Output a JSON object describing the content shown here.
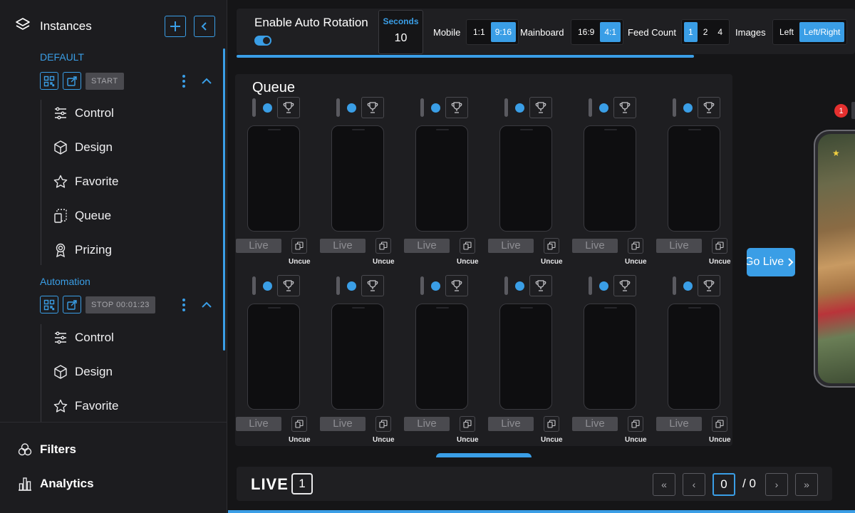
{
  "sidebar": {
    "title": "Instances",
    "instances": [
      {
        "label": "DEFAULT",
        "action_label": "START",
        "items": [
          "Control",
          "Design",
          "Favorite",
          "Queue",
          "Prizing"
        ]
      },
      {
        "label": "Automation",
        "action_label": "STOP 00:01:23",
        "items": [
          "Control",
          "Design",
          "Favorite"
        ]
      }
    ],
    "bottom": [
      "Filters",
      "Analytics"
    ]
  },
  "toolbar": {
    "rotation_label": "Enable Auto Rotation",
    "rotation_enabled": true,
    "seconds_label": "Seconds",
    "seconds_value": "10",
    "mobile_label": "Mobile",
    "mobile_options": [
      "1:1",
      "9:16"
    ],
    "mobile_selected": "9:16",
    "mainboard_label": "Mainboard",
    "mainboard_options": [
      "16:9",
      "4:1"
    ],
    "mainboard_selected": "4:1",
    "feedcount_label": "Feed Count",
    "feedcount_options": [
      "1",
      "2",
      "4"
    ],
    "feedcount_selected": "1",
    "images_label": "Images",
    "images_options": [
      "Left",
      "Left/Right"
    ],
    "images_selected": "Left/Right"
  },
  "queue": {
    "title": "Queue",
    "live_label": "Live",
    "uncue_label": "Uncue",
    "card_count": 12
  },
  "go_live": {
    "label": "Go Live"
  },
  "preview": {
    "badge": "1"
  },
  "livebar": {
    "title": "LIVE",
    "count": "1",
    "page_current": "0",
    "page_total": "/ 0"
  },
  "colors": {
    "accent": "#3a9ee6",
    "background": "#151517",
    "panel": "#1e1e21",
    "badge": "#e5302f"
  }
}
